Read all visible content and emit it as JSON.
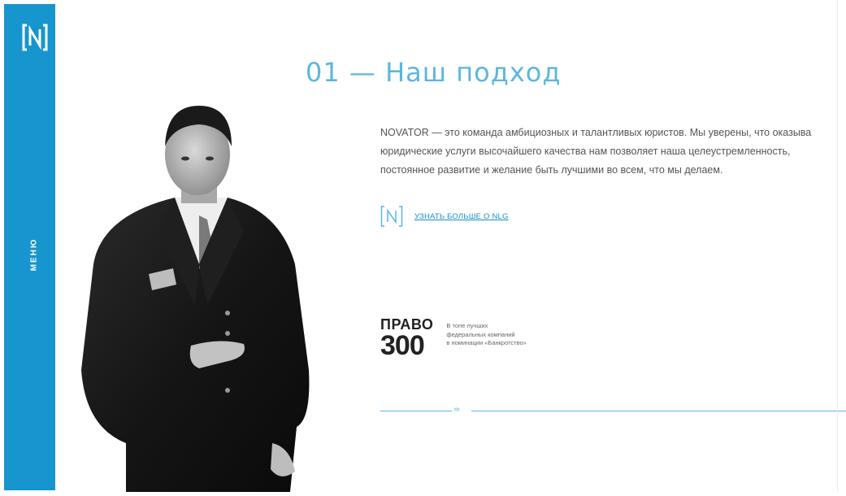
{
  "sidebar": {
    "logo_text": "[N]",
    "menu_label": "МЕНЮ"
  },
  "main": {
    "heading": "01 — Наш подход",
    "description": [
      "NOVATOR — это команда амбициозных и талантливых юристов. Мы уверены, что оказыва",
      "юридические услуги высочайшего качества нам позволяет наша целеустремленность,",
      "постоянное развитие и желание быть лучшими во всем, что мы делаем."
    ],
    "more_link": "УЗНАТЬ БОЛЬШЕ О NLG",
    "award": {
      "badge_title": "ПРАВО",
      "badge_number": "300",
      "lines": [
        "В топе лучших",
        "федеральных компаний",
        "в номинации «Банкротство»"
      ]
    },
    "divider_arrows": "›››"
  },
  "colors": {
    "accent": "#1795cf",
    "heading": "#5bb7dd",
    "link": "#1a8ec4"
  }
}
